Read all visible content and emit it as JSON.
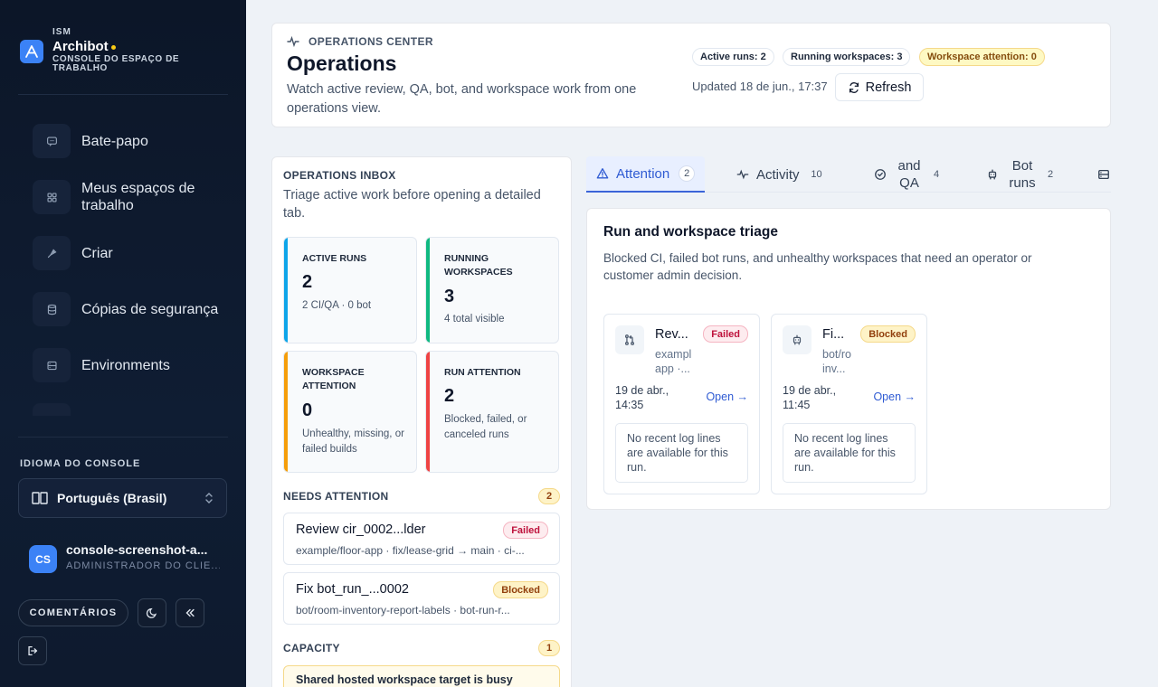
{
  "sidebar": {
    "org": "ISM",
    "app_name": "Archibot",
    "app_subtitle": "CONSOLE DO ESPAÇO DE TRABALHO",
    "nav": [
      {
        "label": "Bate-papo",
        "icon": "chat-icon"
      },
      {
        "label": "Meus espaços de trabalho",
        "icon": "grid-icon"
      },
      {
        "label": "Criar",
        "icon": "rocket-icon"
      },
      {
        "label": "Cópias de segurança",
        "icon": "database-icon"
      },
      {
        "label": "Environments",
        "icon": "server-icon"
      }
    ],
    "language_title": "IDIOMA DO CONSOLE",
    "language_value": "Português (Brasil)",
    "user": {
      "initials": "CS",
      "name": "console-screenshot-a...",
      "role": "ADMINISTRADOR DO CLIE..."
    },
    "feedback_label": "COMENTÁRIOS"
  },
  "header": {
    "eyebrow": "OPERATIONS CENTER",
    "title": "Operations",
    "description": "Watch active review, QA, bot, and workspace work from one operations view.",
    "pills": [
      "Active runs: 2",
      "Running workspaces: 3",
      "Workspace attention: 0"
    ],
    "updated": "Updated 18 de jun., 17:37",
    "refresh_label": "Refresh"
  },
  "inbox": {
    "title": "OPERATIONS INBOX",
    "description": "Triage active work before opening a detailed tab.",
    "stats": [
      {
        "label": "ACTIVE RUNS",
        "value": "2",
        "sub": "2 CI/QA · 0 bot",
        "color": "#0ea5e9"
      },
      {
        "label": "RUNNING WORKSPACES",
        "value": "3",
        "sub": "4 total visible",
        "color": "#10b981"
      },
      {
        "label": "WORKSPACE ATTENTION",
        "value": "0",
        "sub": "Unhealthy, missing, or failed builds",
        "color": "#f59e0b"
      },
      {
        "label": "RUN ATTENTION",
        "value": "2",
        "sub": "Blocked, failed, or canceled runs",
        "color": "#ef4444"
      }
    ],
    "needs_attention": {
      "title": "NEEDS ATTENTION",
      "count": "2",
      "items": [
        {
          "title": "Review cir_0002...lder",
          "status": "Failed",
          "sub": "example/floor-app · fix/lease-grid → main · ci-..."
        },
        {
          "title": "Fix bot_run_...0002",
          "status": "Blocked",
          "sub": "bot/room-inventory-report-labels · bot-run-r..."
        }
      ]
    },
    "capacity": {
      "title": "CAPACITY",
      "count": "1",
      "message": "Shared hosted workspace target is busy"
    }
  },
  "tabs": [
    {
      "label": "Attention",
      "count": "2",
      "icon": "warning-icon"
    },
    {
      "label": "Activity",
      "count": "10",
      "icon": "pulse-icon"
    },
    {
      "label": "and QA",
      "count": "4",
      "icon": "check-circle-icon"
    },
    {
      "label": "Bot runs",
      "count": "2",
      "icon": "bot-icon"
    },
    {
      "label": "",
      "count": "",
      "icon": "server-icon"
    }
  ],
  "triage": {
    "title": "Run and workspace triage",
    "description": "Blocked CI, failed bot runs, and unhealthy workspaces that need an operator or customer admin decision.",
    "cards": [
      {
        "title": "Rev...",
        "status": "Failed",
        "sub": "exampl app ·...",
        "date": "19 de abr., 14:35",
        "open": "Open →",
        "log": "No recent log lines are available for this run.",
        "icon": "git-pull-icon"
      },
      {
        "title": "Fi...",
        "status": "Blocked",
        "sub": "bot/ro inv...",
        "date": "19 de abr., 11:45",
        "open": "Open →",
        "log": "No recent log lines are available for this run.",
        "icon": "bot-icon"
      }
    ]
  }
}
